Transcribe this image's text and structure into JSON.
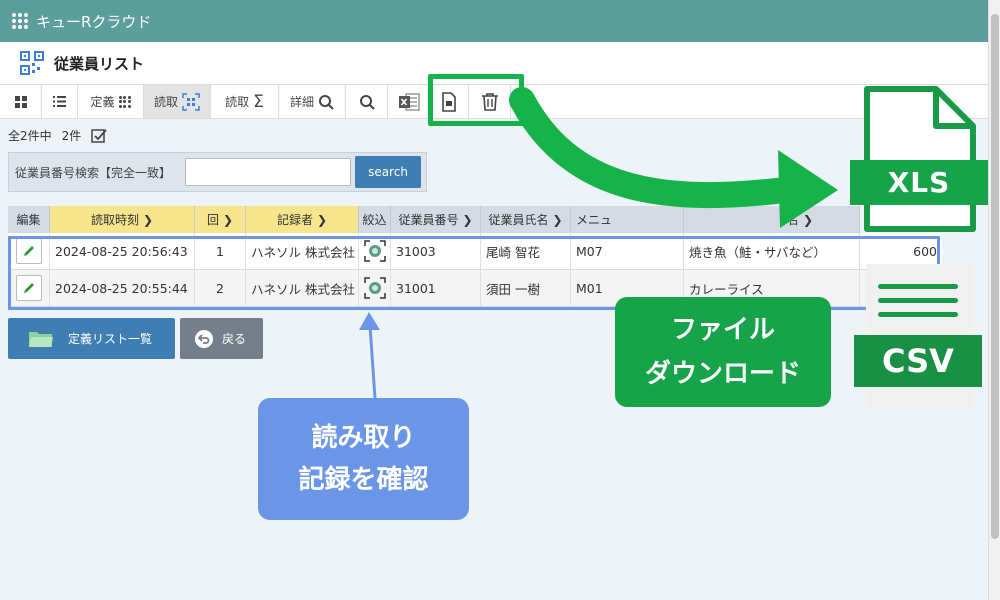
{
  "app": {
    "title": "キューRクラウド"
  },
  "page": {
    "title": "従業員リスト"
  },
  "toolbar": {
    "define_label": "定義",
    "read_label": "読取",
    "read_sum_label": "読取",
    "detail_label": "詳細"
  },
  "count": {
    "total": "全2件中",
    "selected": "2件"
  },
  "search": {
    "label": "従業員番号検索【完全一致】",
    "value": "",
    "button": "search"
  },
  "table": {
    "headers": {
      "edit": "編集",
      "read_time": "読取時刻",
      "times": "回",
      "recorder": "記録者",
      "filter": "絞込",
      "emp_no": "従業員番号",
      "emp_name": "従業員氏名",
      "menu": "メニュ",
      "menu_name": "名"
    },
    "rows": [
      {
        "time": "2024-08-25 20:56:43",
        "times": "1",
        "recorder": "ハネソル 株式会社",
        "emp_no": "31003",
        "name": "尾崎 智花",
        "menu": "M07",
        "dish": "焼き魚",
        "dish_tail": "（鮭・サバなど）",
        "price": "600"
      },
      {
        "time": "2024-08-25 20:55:44",
        "times": "2",
        "recorder": "ハネソル 株式会社",
        "emp_no": "31001",
        "name": "須田 一樹",
        "menu": "M01",
        "dish": "カレーライス",
        "dish_tail": "",
        "price": ""
      }
    ]
  },
  "buttons": {
    "list": "定義リスト一覧",
    "back": "戻る"
  },
  "annotations": {
    "read_line1": "読み取り",
    "read_line2": "記録を確認",
    "dl_line1": "ファイル",
    "dl_line2": "ダウンロード",
    "xls": "XLS",
    "csv": "CSV"
  },
  "colors": {
    "header": "#5b9e9c",
    "primary": "#3f7eb3",
    "callout_blue": "#6b96e8",
    "callout_green": "#16a34a",
    "header_yellow": "#f6e58d"
  }
}
